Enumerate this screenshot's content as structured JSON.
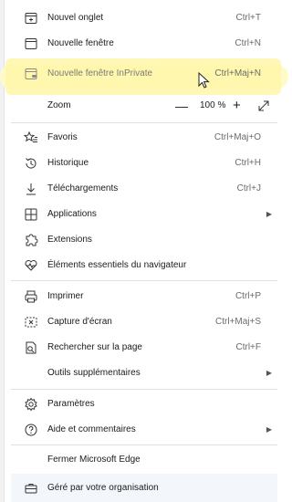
{
  "menu": {
    "new_tab": {
      "label": "Nouvel onglet",
      "shortcut": "Ctrl+T",
      "icon": "new-tab-icon"
    },
    "new_window": {
      "label": "Nouvelle fenêtre",
      "shortcut": "Ctrl+N",
      "icon": "window-icon"
    },
    "new_inprivate": {
      "label": "Nouvelle fenêtre InPrivate",
      "shortcut": "Ctrl+Maj+N",
      "icon": "inprivate-icon"
    },
    "zoom": {
      "label": "Zoom",
      "minus": "—",
      "value": "100 %",
      "plus": "+",
      "fullscreen_icon": "fullscreen-icon"
    },
    "favorites": {
      "label": "Favoris",
      "shortcut": "Ctrl+Maj+O",
      "icon": "favorites-icon"
    },
    "history": {
      "label": "Historique",
      "shortcut": "Ctrl+H",
      "icon": "history-icon"
    },
    "downloads": {
      "label": "Téléchargements",
      "shortcut": "Ctrl+J",
      "icon": "download-icon"
    },
    "apps": {
      "label": "Applications",
      "icon": "apps-icon"
    },
    "extensions": {
      "label": "Extensions",
      "icon": "extensions-icon"
    },
    "essentials": {
      "label": "Éléments essentiels du navigateur",
      "icon": "heartbeat-icon"
    },
    "print": {
      "label": "Imprimer",
      "shortcut": "Ctrl+P",
      "icon": "print-icon"
    },
    "screenshot": {
      "label": "Capture d'écran",
      "shortcut": "Ctrl+Maj+S",
      "icon": "screenshot-icon"
    },
    "find": {
      "label": "Rechercher sur la page",
      "shortcut": "Ctrl+F",
      "icon": "find-icon"
    },
    "more_tools": {
      "label": "Outils supplémentaires"
    },
    "settings": {
      "label": "Paramètres",
      "icon": "gear-icon"
    },
    "help": {
      "label": "Aide et commentaires",
      "icon": "help-icon"
    },
    "close": {
      "label": "Fermer Microsoft Edge"
    },
    "managed": {
      "label": "Géré par votre organisation",
      "icon": "briefcase-icon"
    }
  },
  "colors": {
    "highlight": "#fff6a8",
    "text": "#1b1b1b",
    "shortcut": "#6b6b6b",
    "separator": "#e1e1e1"
  }
}
